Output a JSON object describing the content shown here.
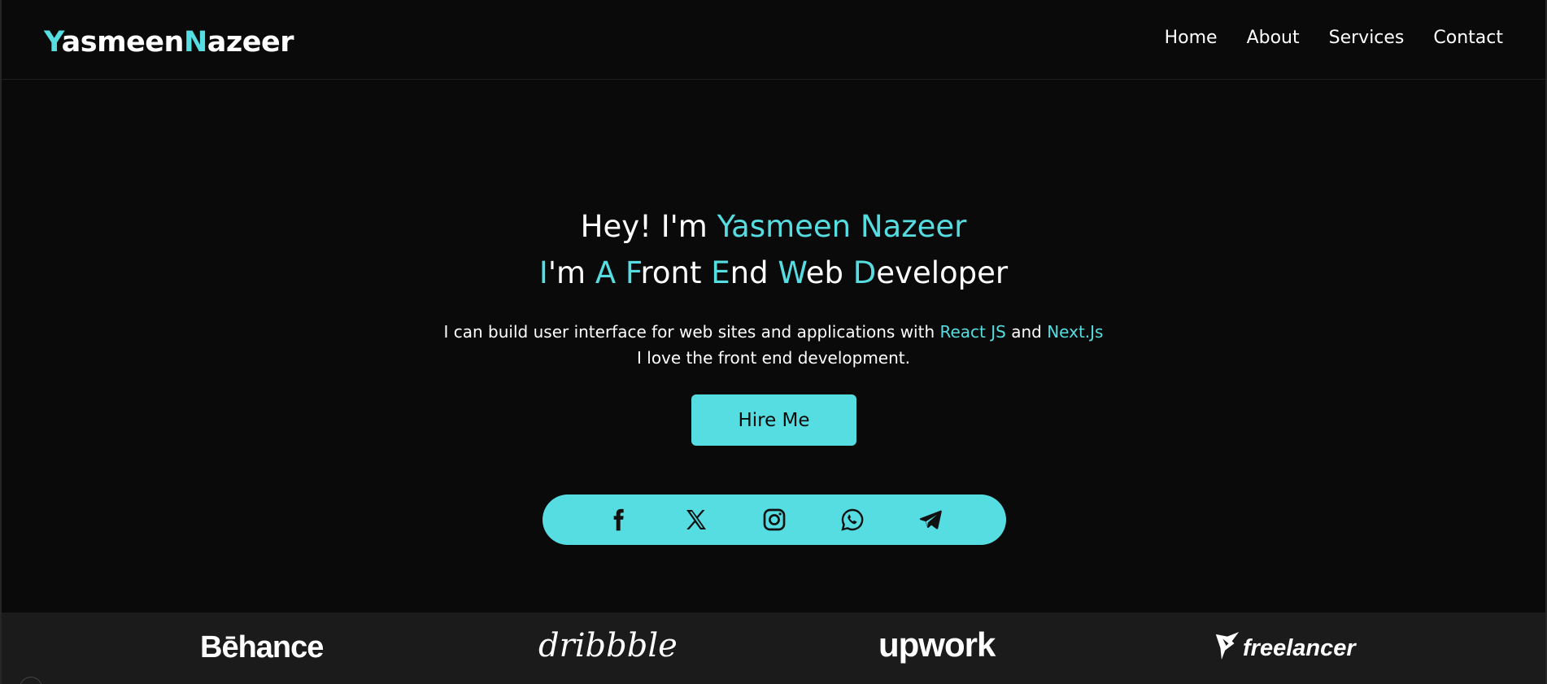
{
  "logo": {
    "first_initial": "Y",
    "first_rest": "asmeen",
    "last_initial": "N",
    "last_rest": "azeer"
  },
  "nav": {
    "items": [
      "Home",
      "About",
      "Services",
      "Contact"
    ]
  },
  "hero": {
    "line1_prefix": "Hey! I'm ",
    "line1_name": "Yasmeen Nazeer",
    "line2": [
      {
        "accent": "I",
        "rest": "'m "
      },
      {
        "accent": "A",
        "rest": " "
      },
      {
        "accent": "F",
        "rest": "ront "
      },
      {
        "accent": "E",
        "rest": "nd "
      },
      {
        "accent": "W",
        "rest": "eb "
      },
      {
        "accent": "D",
        "rest": "eveloper"
      }
    ],
    "desc_prefix": "I can build user interface for web sites and applications with ",
    "desc_tech1": "React JS",
    "desc_and": " and ",
    "desc_tech2": "Next.Js",
    "desc_line2": "I love the front end development."
  },
  "cta": {
    "hire_label": "Hire Me"
  },
  "social": {
    "icons": [
      "facebook-icon",
      "x-icon",
      "instagram-icon",
      "whatsapp-icon",
      "telegram-icon"
    ]
  },
  "brands": {
    "behance": "Bēhance",
    "dribbble": "dribbble",
    "upwork": "upwork",
    "freelancer": "freelancer"
  },
  "colors": {
    "accent": "#56dde2",
    "background": "#0b0a0a",
    "brand_strip": "#1b1b1b",
    "text": "#ffffff"
  }
}
